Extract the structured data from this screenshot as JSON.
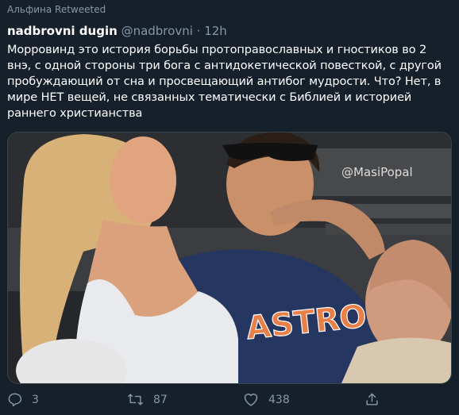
{
  "retweet_label": "Альфина Retweeted",
  "author": {
    "name": "nadbrovni dugin",
    "handle": "@nadbrovni",
    "separator": "·",
    "time": "12h"
  },
  "text_lines": [
    "Морровинд это история борьбы протоправославных и гностиков во 2",
    "внэ, с одной стороны три бога с антидокетической повесткой, с другой",
    "пробуждающий от сна и просвещающий антибог мудрости. Что? Нет, в",
    "мире НЕТ вещей, не связанных тематически с Библией и историей",
    "раннего христианства"
  ],
  "media": {
    "watermark": "@MasiPopal",
    "shirt_text": "ASTROS"
  },
  "actions": {
    "replies": "3",
    "retweets": "87",
    "likes": "438"
  },
  "icons": {
    "reply": "reply-icon",
    "retweet": "retweet-icon",
    "like": "heart-icon",
    "share": "share-icon"
  },
  "colors": {
    "background": "#15202b",
    "secondary_text": "#8899a6",
    "border": "#38444d"
  }
}
